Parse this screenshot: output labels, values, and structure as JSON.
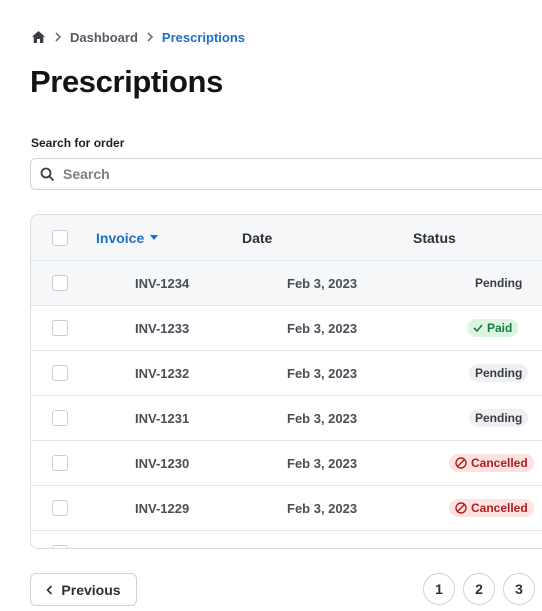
{
  "breadcrumb": {
    "home_icon": "home-icon",
    "items": [
      "Dashboard",
      "Prescriptions"
    ]
  },
  "page": {
    "title": "Prescriptions"
  },
  "search": {
    "label": "Search for order",
    "placeholder": "Search",
    "value": ""
  },
  "table": {
    "columns": [
      "Invoice",
      "Date",
      "Status"
    ],
    "sort_column": "Invoice",
    "rows": [
      {
        "invoice": "INV-1234",
        "date": "Feb 3, 2023",
        "status": "Pending"
      },
      {
        "invoice": "INV-1233",
        "date": "Feb 3, 2023",
        "status": "Paid"
      },
      {
        "invoice": "INV-1232",
        "date": "Feb 3, 2023",
        "status": "Pending"
      },
      {
        "invoice": "INV-1231",
        "date": "Feb 3, 2023",
        "status": "Pending"
      },
      {
        "invoice": "INV-1230",
        "date": "Feb 3, 2023",
        "status": "Cancelled"
      },
      {
        "invoice": "INV-1229",
        "date": "Feb 3, 2023",
        "status": "Cancelled"
      }
    ]
  },
  "pagination": {
    "previous_label": "Previous",
    "pages": [
      "1",
      "2",
      "3"
    ]
  },
  "colors": {
    "accent": "#1f6fc5",
    "paid_bg": "#dcf5e3",
    "paid_text": "#1c7c3d",
    "cancelled_bg": "#fde2e2",
    "cancelled_text": "#b11d1d",
    "pending_bg": "#eef0f3"
  }
}
